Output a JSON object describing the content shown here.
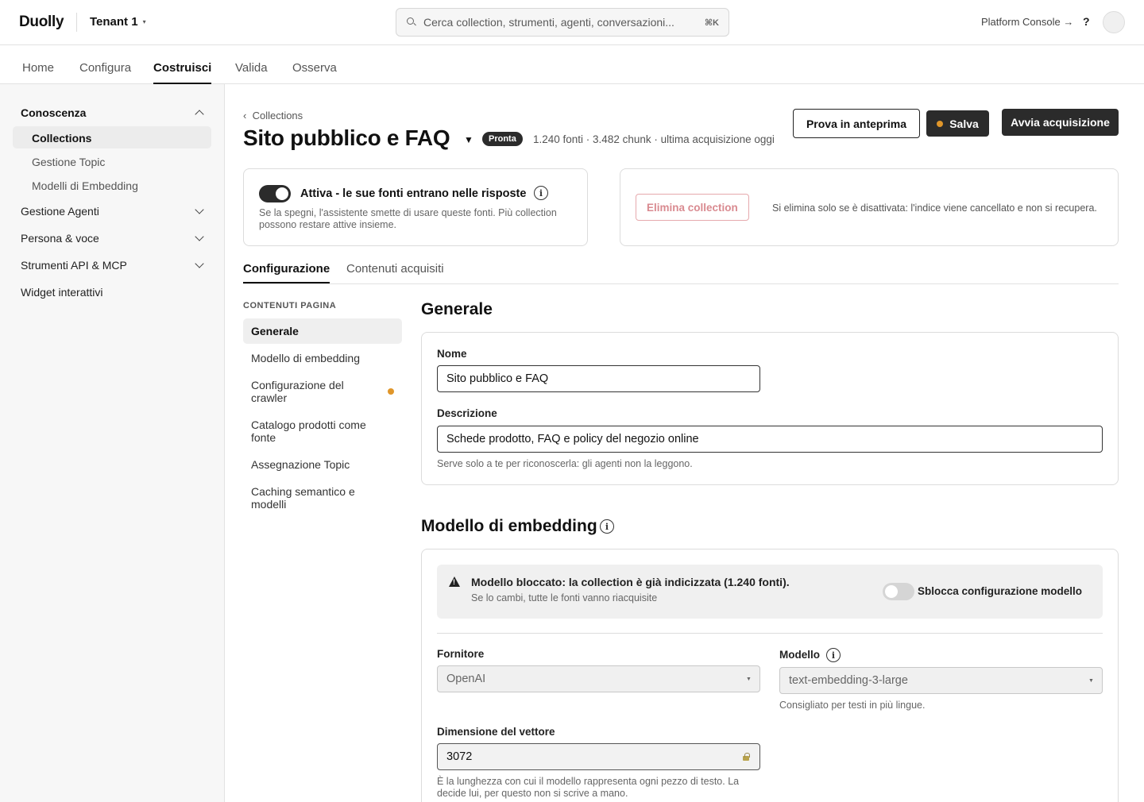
{
  "header": {
    "logo": "Duolly",
    "tenant": "Tenant 1",
    "tenant_caret": "▾",
    "search_placeholder": "Cerca collection, strumenti, agenti, conversazioni...",
    "search_shortcut": "⌘K",
    "platform_console": "Platform Console →",
    "help": "?"
  },
  "nav": {
    "tabs": [
      {
        "label": "Home"
      },
      {
        "label": "Configura"
      },
      {
        "label": "Costruisci"
      },
      {
        "label": "Valida"
      },
      {
        "label": "Osserva"
      }
    ],
    "active": "Costruisci"
  },
  "sidebar": {
    "sections": [
      {
        "label": "Conoscenza",
        "expanded": true,
        "items": [
          "Collections",
          "Gestione Topic",
          "Modelli di Embedding"
        ]
      },
      {
        "label": "Gestione Agenti",
        "expanded": false
      },
      {
        "label": "Persona & voce",
        "expanded": false
      },
      {
        "label": "Strumenti API & MCP",
        "expanded": false
      },
      {
        "label": "Widget interattivi"
      }
    ],
    "active_item": "Collections"
  },
  "page": {
    "breadcrumb": "Collections",
    "breadcrumb_chevron": "‹",
    "title": "Sito pubblico e FAQ",
    "title_caret": "▼",
    "status_badge": "Pronta",
    "meta": "1.240 fonti · 3.482 chunk · ultima acquisizione oggi",
    "buttons": {
      "preview": "Prova in anteprima",
      "save": "Salva",
      "acquire": "Avvia acquisizione"
    },
    "save_dirty_color": "#e0962a"
  },
  "active_card": {
    "toggle_on": true,
    "title": "Attiva - le sue fonti entrano nelle risposte",
    "description": "Se la spegni, l'assistente smette di usare queste fonti. Più collection possono restare attive insieme."
  },
  "delete_card": {
    "button": "Elimina collection",
    "note": "Si elimina solo se è disattivata: l'indice viene cancellato e non si recupera."
  },
  "content_tabs": [
    {
      "label": "Configurazione"
    },
    {
      "label": "Contenuti acquisiti"
    }
  ],
  "page_contents": {
    "heading": "CONTENUTI PAGINA",
    "items": [
      "Generale",
      "Modello di embedding",
      "Configurazione del crawler",
      "Catalogo prodotti come fonte",
      "Assegnazione Topic",
      "Caching semantico e modelli"
    ],
    "active": "Generale"
  },
  "general": {
    "heading": "Generale",
    "name_label": "Nome",
    "name_value": "Sito pubblico e FAQ",
    "description_label": "Descrizione",
    "description_value": "Schede prodotto, FAQ e policy del negozio online",
    "description_help": "Serve solo a te per riconoscerla: gli agenti non la leggono."
  },
  "embedding": {
    "heading": "Modello di embedding",
    "warning_title": "Modello bloccato: la collection è già indicizzata (1.240 fonti).",
    "warning_sub": "Se lo cambi, tutte le fonti vanno riacquisite",
    "unlock_label": "Sblocca configurazione modello",
    "unlock_on": false,
    "provider_label": "Fornitore",
    "provider_value": "OpenAI",
    "model_label": "Modello",
    "model_value": "text-embedding-3-large",
    "model_help": "Consigliato per testi in più lingue.",
    "vector_label": "Dimensione del vettore",
    "vector_value": "3072",
    "vector_help": "È la lunghezza con cui il modello rappresenta ogni pezzo di testo. La decide lui, per questo non si scrive a mano."
  }
}
